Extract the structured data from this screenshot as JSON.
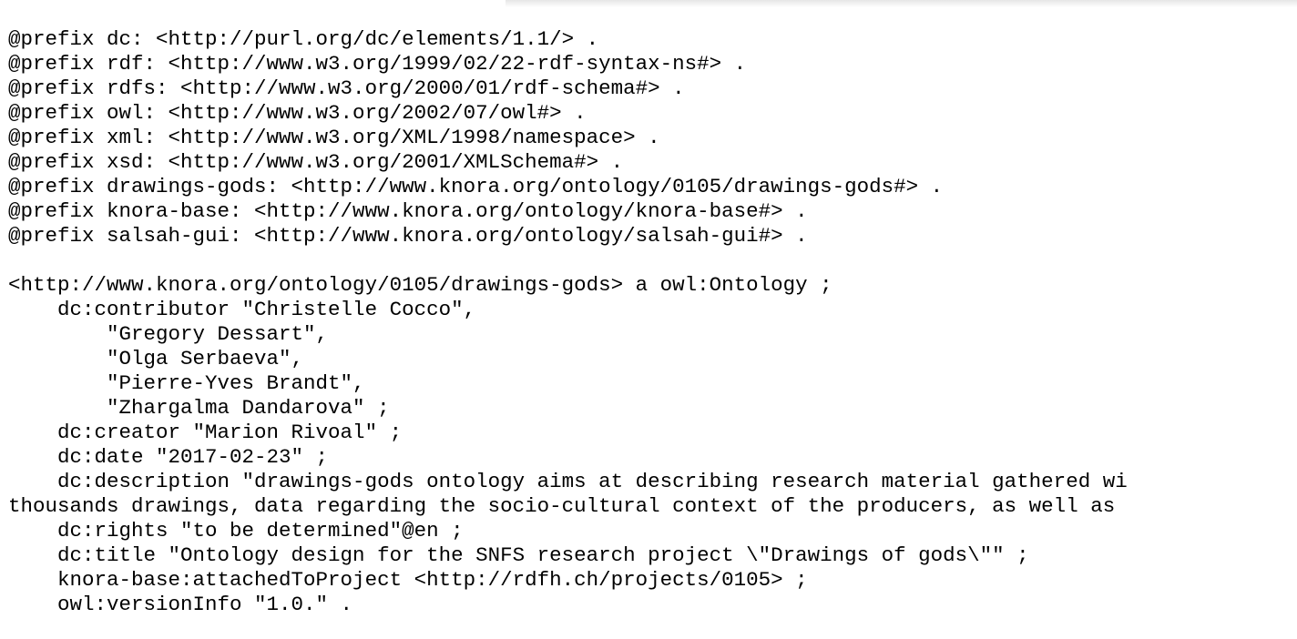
{
  "document": {
    "prefixes": [
      "@prefix dc: <http://purl.org/dc/elements/1.1/> .",
      "@prefix rdf: <http://www.w3.org/1999/02/22-rdf-syntax-ns#> .",
      "@prefix rdfs: <http://www.w3.org/2000/01/rdf-schema#> .",
      "@prefix owl: <http://www.w3.org/2002/07/owl#> .",
      "@prefix xml: <http://www.w3.org/XML/1998/namespace> .",
      "@prefix xsd: <http://www.w3.org/2001/XMLSchema#> .",
      "@prefix drawings-gods: <http://www.knora.org/ontology/0105/drawings-gods#> .",
      "@prefix knora-base: <http://www.knora.org/ontology/knora-base#> .",
      "@prefix salsah-gui: <http://www.knora.org/ontology/salsah-gui#> ."
    ],
    "ontology": [
      "<http://www.knora.org/ontology/0105/drawings-gods> a owl:Ontology ;",
      "    dc:contributor \"Christelle Cocco\",",
      "        \"Gregory Dessart\",",
      "        \"Olga Serbaeva\",",
      "        \"Pierre-Yves Brandt\",",
      "        \"Zhargalma Dandarova\" ;",
      "    dc:creator \"Marion Rivoal\" ;",
      "    dc:date \"2017-02-23\" ;",
      "    dc:description \"drawings-gods ontology aims at describing research material gathered wi",
      "thousands drawings, data regarding the socio-cultural context of the producers, as well as",
      "    dc:rights \"to be determined\"@en ;",
      "    dc:title \"Ontology design for the SNFS research project \\\"Drawings of gods\\\"\" ;",
      "    knora-base:attachedToProject <http://rdfh.ch/projects/0105> ;",
      "    owl:versionInfo \"1.0.\" ."
    ]
  }
}
